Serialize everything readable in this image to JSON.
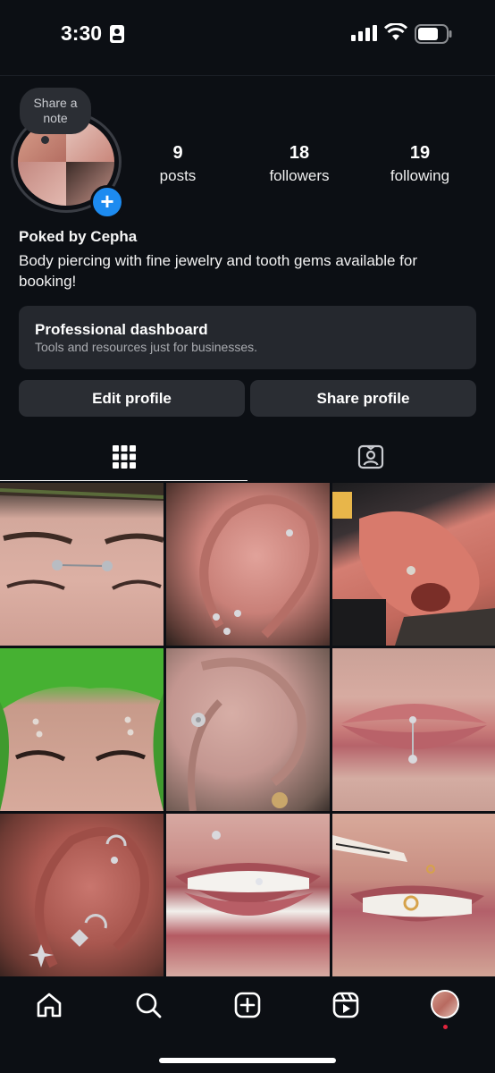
{
  "status_bar": {
    "time": "3:30"
  },
  "profile": {
    "note_bubble": "Share a note",
    "stats": [
      {
        "value": "9",
        "label": "posts"
      },
      {
        "value": "18",
        "label": "followers"
      },
      {
        "value": "19",
        "label": "following"
      }
    ],
    "name": "Poked by Cepha",
    "bio": "Body piercing with fine jewelry and tooth gems available for booking!"
  },
  "dashboard": {
    "title": "Professional dashboard",
    "subtitle": "Tools and resources just for businesses."
  },
  "buttons": {
    "edit": "Edit profile",
    "share": "Share profile"
  },
  "tabs": [
    {
      "icon": "grid-icon",
      "active": true
    },
    {
      "icon": "tagged-icon",
      "active": false
    }
  ],
  "posts": [
    {
      "subject": "bridge piercing"
    },
    {
      "subject": "ear helix and lobe piercings"
    },
    {
      "subject": "nostril piercing"
    },
    {
      "subject": "eyebrow piercings"
    },
    {
      "subject": "flat and lobe piercing"
    },
    {
      "subject": "labret piercing"
    },
    {
      "subject": "ear curated piercings"
    },
    {
      "subject": "tooth gem and lip piercing"
    },
    {
      "subject": "gold tooth gem"
    }
  ],
  "bottom_nav": [
    "home-icon",
    "search-icon",
    "create-icon",
    "reels-icon",
    "profile-avatar"
  ],
  "colors": {
    "background": "#0c0f14",
    "card": "#25282e",
    "button": "#2a2d33",
    "accent_blue": "#1d8bf0",
    "notification_red": "#e0243d"
  }
}
